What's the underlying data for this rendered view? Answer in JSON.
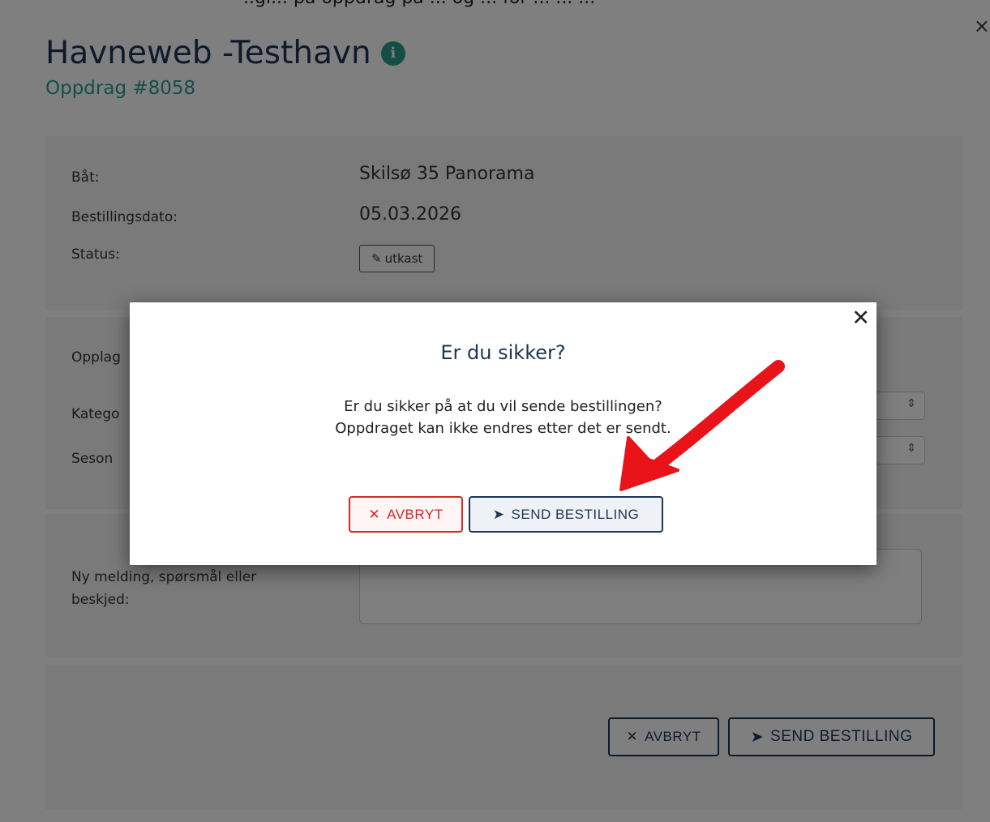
{
  "caption": "..gi... på oppdrag på ... og ... for ... ... ...",
  "page": {
    "title": "Havneweb -Testhavn",
    "subtitle": "Oppdrag #8058"
  },
  "details": {
    "boat_label": "Båt:",
    "boat_value": "Skilsø 35 Panorama",
    "date_label": "Bestillingsdato:",
    "date_value": "05.03.2026",
    "status_label": "Status:",
    "status_value": "utkast"
  },
  "form": {
    "storage_label": "Opplag",
    "category_label": "Katego",
    "season_label": "Seson",
    "message_label": "Ny melding, spørsmål eller beskjed:"
  },
  "footer": {
    "cancel_label": "AVBRYT",
    "send_label": "SEND BESTILLING"
  },
  "confirm_dialog": {
    "title": "Er du sikker?",
    "line1": "Er du sikker på at du vil sende bestillingen?",
    "line2": "Oppdraget kan ikke endres etter det er sendt.",
    "cancel_label": "AVBRYT",
    "send_label": "SEND BESTILLING"
  },
  "colors": {
    "primary": "#1d3557",
    "teal": "#2a9d8f",
    "danger": "#d62828",
    "annotation_arrow": "#e8141a"
  },
  "icons": [
    "info-icon",
    "edit-icon",
    "close-icon",
    "times-icon",
    "paper-plane-icon",
    "select-caret-icon"
  ]
}
